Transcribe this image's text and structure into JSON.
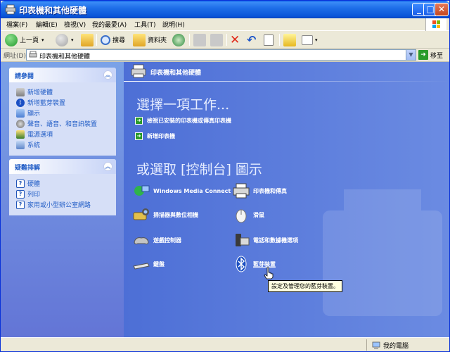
{
  "window": {
    "title": "印表機和其他硬體",
    "min_glyph": "_",
    "max_glyph": "□",
    "close_glyph": "✕"
  },
  "menu": [
    "檔案(F)",
    "編輯(E)",
    "檢視(V)",
    "我的最愛(A)",
    "工具(T)",
    "說明(H)"
  ],
  "toolbar": {
    "back_label": "上一頁",
    "search_label": "搜尋",
    "folders_label": "資料夾"
  },
  "address": {
    "label": "網址(D)",
    "value": "印表機和其他硬體",
    "go_label": "移至"
  },
  "see_also": {
    "title": "請參閱",
    "items": [
      {
        "label": "新增硬體",
        "icon": "add-hardware-icon"
      },
      {
        "label": "新增藍芽裝置",
        "icon": "bluetooth-icon"
      },
      {
        "label": "顯示",
        "icon": "display-icon"
      },
      {
        "label": "聲音、語音、和音訊裝置",
        "icon": "sound-icon"
      },
      {
        "label": "電源選項",
        "icon": "power-icon"
      },
      {
        "label": "系統",
        "icon": "system-icon"
      }
    ]
  },
  "troubleshooters": {
    "title": "疑難排解",
    "items": [
      {
        "label": "硬體",
        "icon": "help-icon"
      },
      {
        "label": "列印",
        "icon": "help-icon"
      },
      {
        "label": "家用或小型辦公室網路",
        "icon": "help-icon"
      }
    ]
  },
  "main": {
    "header_title": "印表機和其他硬體",
    "pick_task": "選擇一項工作...",
    "tasks": [
      "檢視已安裝的印表機或傳真印表機",
      "新增印表機"
    ],
    "pick_icon": "或選取 [控制台] 圖示",
    "icons": [
      {
        "label": "Windows Media Connect",
        "icon": "media-connect-icon"
      },
      {
        "label": "印表機和傳真",
        "icon": "printer-fax-icon"
      },
      {
        "label": "掃描器與數位相機",
        "icon": "scanner-camera-icon"
      },
      {
        "label": "滑鼠",
        "icon": "mouse-icon"
      },
      {
        "label": "遊戲控制器",
        "icon": "game-controller-icon"
      },
      {
        "label": "電話和數據機選項",
        "icon": "phone-modem-icon"
      },
      {
        "label": "鍵盤",
        "icon": "keyboard-icon"
      },
      {
        "label": "藍芽裝置",
        "icon": "bluetooth-icon"
      }
    ],
    "tooltip": "設定及管理您的藍芽裝置。"
  },
  "status": {
    "label": "我的電腦"
  },
  "colors": {
    "title_blue": "#0a55d8",
    "pane_blue": "#6375d6",
    "link_blue": "#215dc6",
    "task_green": "#2a9b2a"
  }
}
